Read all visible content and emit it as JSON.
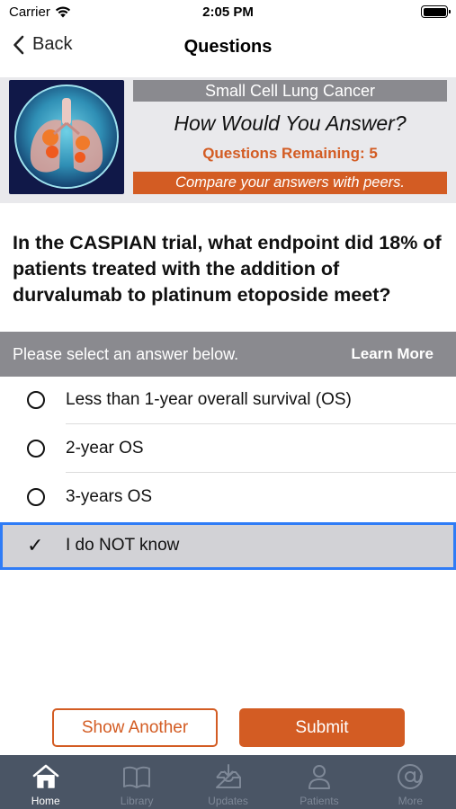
{
  "status_bar": {
    "carrier": "Carrier",
    "time": "2:05 PM"
  },
  "nav": {
    "back_label": "Back",
    "title": "Questions"
  },
  "banner": {
    "topic": "Small Cell Lung Cancer",
    "headline": "How Would You Answer?",
    "remaining": "Questions Remaining: 5",
    "compare": "Compare your answers with peers.",
    "image_icon": "lungs-illustration"
  },
  "question": {
    "text": "In the CASPIAN trial, what endpoint did 18% of patients treated with the addition of durvalumab to platinum etoposide meet?"
  },
  "instructions": {
    "text": "Please select an answer below.",
    "learn_more": "Learn More"
  },
  "answers": [
    {
      "label": "Less than 1-year overall survival (OS)",
      "selected": false
    },
    {
      "label": "2-year OS",
      "selected": false
    },
    {
      "label": "3-years OS",
      "selected": false
    },
    {
      "label": "I do NOT know",
      "selected": true,
      "check": "✓"
    }
  ],
  "buttons": {
    "show_another": "Show Another",
    "submit": "Submit"
  },
  "tabs": [
    {
      "label": "Home",
      "icon": "home-icon",
      "active": true
    },
    {
      "label": "Library",
      "icon": "book-icon",
      "active": false
    },
    {
      "label": "Updates",
      "icon": "inbox-download-icon",
      "active": false
    },
    {
      "label": "Patients",
      "icon": "person-icon",
      "active": false
    },
    {
      "label": "More",
      "icon": "at-sign-icon",
      "active": false
    }
  ],
  "colors": {
    "accent": "#d35c23",
    "gray_bar": "#8a8a8f",
    "tab_bar": "#4a5565",
    "selection_border": "#2f7cf6",
    "selection_fill": "#d2d2d6"
  }
}
